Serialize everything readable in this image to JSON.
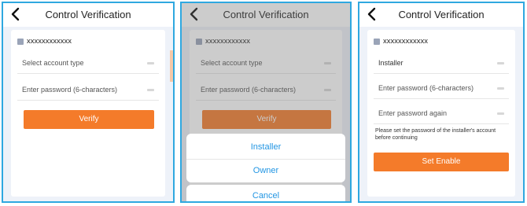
{
  "screens": [
    {
      "title": "Control Verification",
      "account": "xxxxxxxxxxxx",
      "account_type_placeholder": "Select account type",
      "password_placeholder": "Enter password (6-characters)",
      "verify_label": "Verify"
    },
    {
      "title": "Control Verification",
      "account": "xxxxxxxxxxxx",
      "account_type_placeholder": "Select account type",
      "password_placeholder": "Enter password (6-characters)",
      "verify_label": "Verify",
      "action_sheet": {
        "options": [
          "Installer",
          "Owner"
        ],
        "cancel_label": "Cancel"
      }
    },
    {
      "title": "Control Verification",
      "account": "xxxxxxxxxxxx",
      "account_type_value": "Installer",
      "password_placeholder": "Enter password (6-characters)",
      "password_again_placeholder": "Enter password again",
      "note": "Please set the password of the installer's account before continuing",
      "set_enable_label": "Set Enable"
    }
  ],
  "colors": {
    "accent": "#f47b2a",
    "link": "#2396e3",
    "frame": "#2fa8e0"
  },
  "icons": [
    "back-arrow-icon",
    "account-icon",
    "eye-icon",
    "chevron-icon"
  ]
}
